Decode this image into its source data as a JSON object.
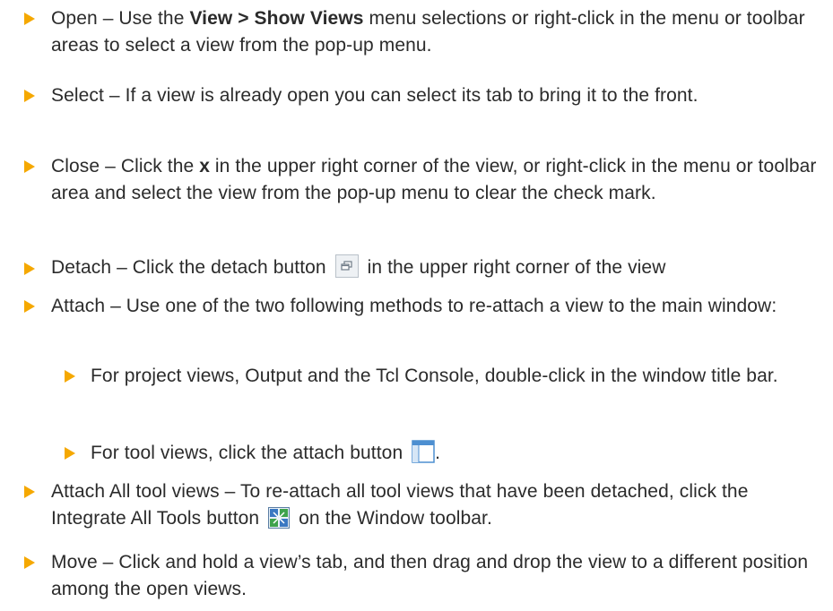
{
  "bullets": {
    "open": {
      "pre": "Open – Use the ",
      "bold": "View > Show Views",
      "post": " menu selections or right-click in the menu or toolbar areas to select a view from the pop-up menu."
    },
    "select": {
      "text": "Select – If a view is already open you can select its tab to bring it to the front."
    },
    "close": {
      "pre": "Close – Click the ",
      "bold": "x",
      "post": " in the upper right corner of the view, or right-click in the menu or toolbar area and select the view from the pop-up menu to clear the check mark."
    },
    "detach": {
      "pre": "Detach – Click the detach button",
      "post": "in the upper right corner of the view",
      "icon": "detach-icon"
    },
    "attach": {
      "text": "Attach – Use one of the two following methods to re-attach a view to the main window:",
      "sub": {
        "project": {
          "text": "For project views, Output and the Tcl Console, double-click in the window title bar."
        },
        "tool": {
          "pre": "For tool views, click the attach button",
          "post": ".",
          "icon": "attach-window-icon"
        }
      }
    },
    "attach_all": {
      "pre": "Attach All tool views – To re-attach all tool views that have been detached, click the Integrate All Tools button",
      "post": "on the Window toolbar.",
      "icon": "integrate-all-tools-icon"
    },
    "move": {
      "text": "Move – Click and hold a view’s tab, and then drag and drop the view to a different position among the open views."
    }
  },
  "colors": {
    "bullet": "#f5a800",
    "text": "#2b2b2b"
  }
}
